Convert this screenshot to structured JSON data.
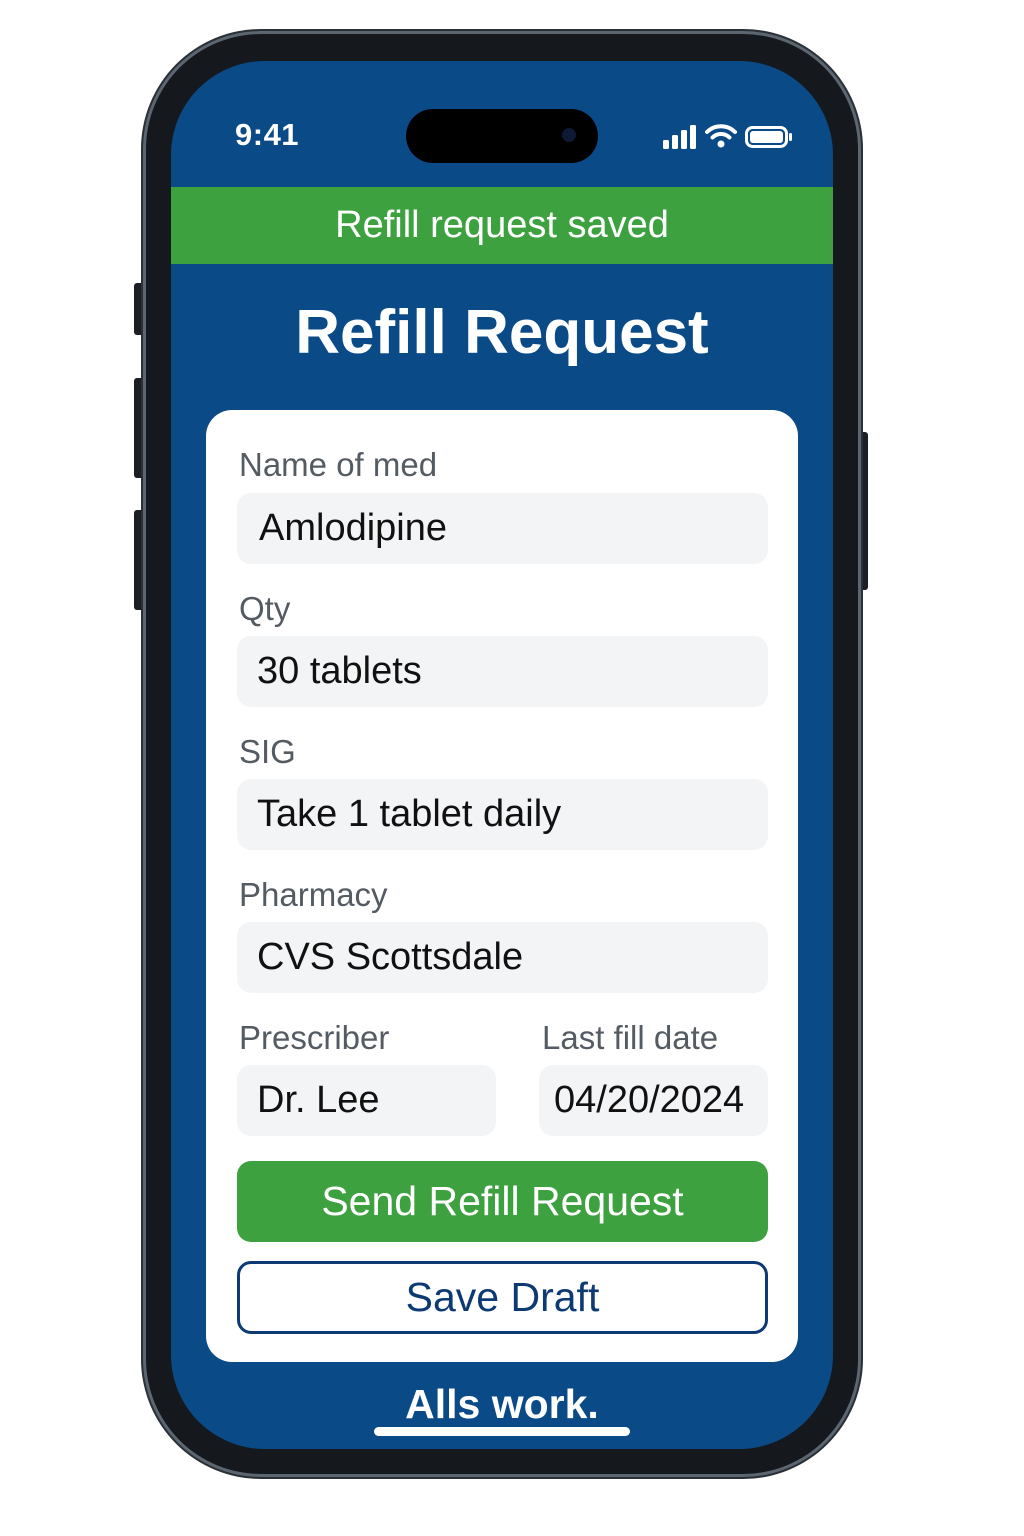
{
  "status_bar": {
    "time": "9:41",
    "icons": [
      "signal-icon",
      "wifi-icon",
      "battery-icon"
    ]
  },
  "toast": {
    "message": "Refill request saved"
  },
  "header": {
    "title": "Refill Request"
  },
  "form": {
    "med_name": {
      "label": "Name of med",
      "value": "Amlodipine"
    },
    "qty": {
      "label": "Qty",
      "value": "30 tablets"
    },
    "sig": {
      "label": "SIG",
      "value": "Take 1 tablet daily"
    },
    "pharmacy": {
      "label": "Pharmacy",
      "value": "CVS Scottsdale"
    },
    "prescriber": {
      "label": "Prescriber",
      "value": "Dr. Lee"
    },
    "last_fill_date": {
      "label": "Last fill date",
      "value": "04/20/2024"
    }
  },
  "actions": {
    "send_label": "Send Refill Request",
    "save_draft_label": "Save Draft"
  },
  "footer": {
    "text": "Alls work."
  },
  "colors": {
    "screen_background": "#0a4a86",
    "success_green": "#3ea140",
    "outline_navy": "#0e3a74",
    "field_background": "#f3f4f6"
  }
}
